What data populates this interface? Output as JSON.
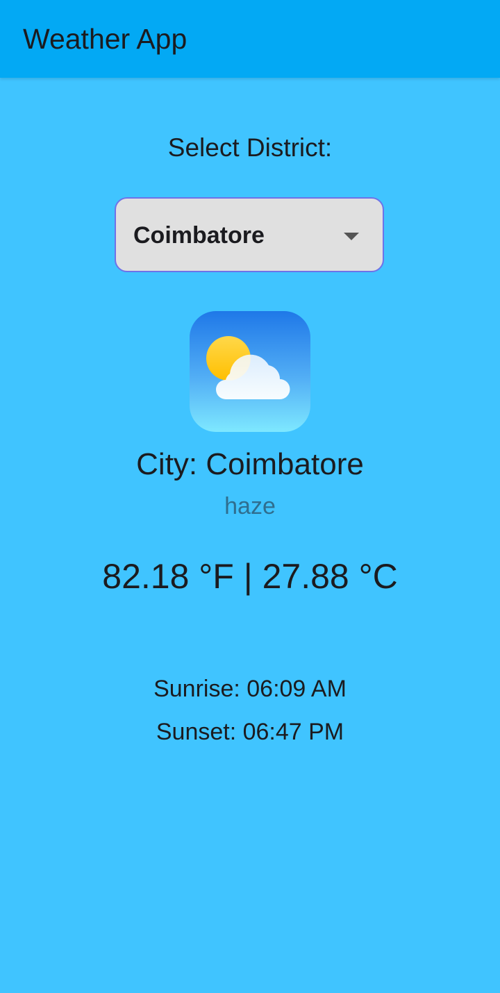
{
  "appbar": {
    "title": "Weather App",
    "color": "#03a9f4"
  },
  "background_color": "#40c4ff",
  "district_selector": {
    "label": "Select District:",
    "selected_value": "Coimbatore",
    "icon": "chevron-down-icon"
  },
  "weather": {
    "icon": "partly-cloudy-icon",
    "city_text": "City: Coimbatore",
    "condition": "haze",
    "temperature_text": "82.18 °F | 27.88 °C",
    "sunrise_text": "Sunrise: 06:09 AM",
    "sunset_text": "Sunset: 06:47 PM"
  }
}
